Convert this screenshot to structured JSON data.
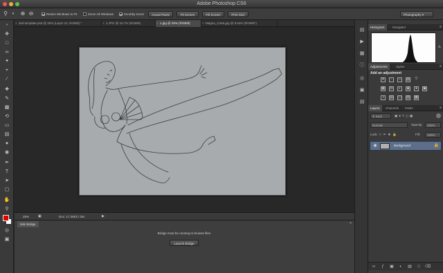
{
  "app_title": "Adobe Photoshop CS6",
  "options_bar": {
    "resize_windows": "Resize Windows to Fit",
    "zoom_all": "Zoom All Windows",
    "scrubby_zoom": "Scrubby Zoom",
    "actual_pixels": "Actual Pixels",
    "fit_screen": "Fit Screen",
    "fill_screen": "Fill Screen",
    "print_size": "Print Size",
    "workspace": "Photography"
  },
  "tabs": [
    "dvd template.psd @ 25% (Layer 12, RGB/8) *",
    "2.JPG @ 16.7% (RGB/8)",
    "1.jpg @ 25% (RGB/8)",
    "Magna_Carta.jpg @ 8.53% (RGB/8*)"
  ],
  "status": {
    "zoom": "25%",
    "doc": "Doc: 17.2M/17.2M"
  },
  "mini_bridge": {
    "tab": "Mini Bridge",
    "message": "Bridge must be running to browse files.",
    "launch": "Launch Bridge"
  },
  "panels": {
    "histogram_tab": "Histogram",
    "navigator_tab": "Navigator",
    "adjustments_tab": "Adjustments",
    "styles_tab": "Styles",
    "add_adjustment": "Add an adjustment",
    "layers_tab": "Layers",
    "channels_tab": "Channels",
    "paths_tab": "Paths",
    "kind": "Kind",
    "blend_mode": "Normal",
    "opacity_label": "Opacity:",
    "opacity": "100%",
    "lock_label": "Lock:",
    "fill_label": "Fill:",
    "fill": "100%",
    "layer_name": "Background"
  },
  "colors": {
    "foreground": "#e00000",
    "background": "#ffffff",
    "selected_layer": "#5c6e8a"
  }
}
